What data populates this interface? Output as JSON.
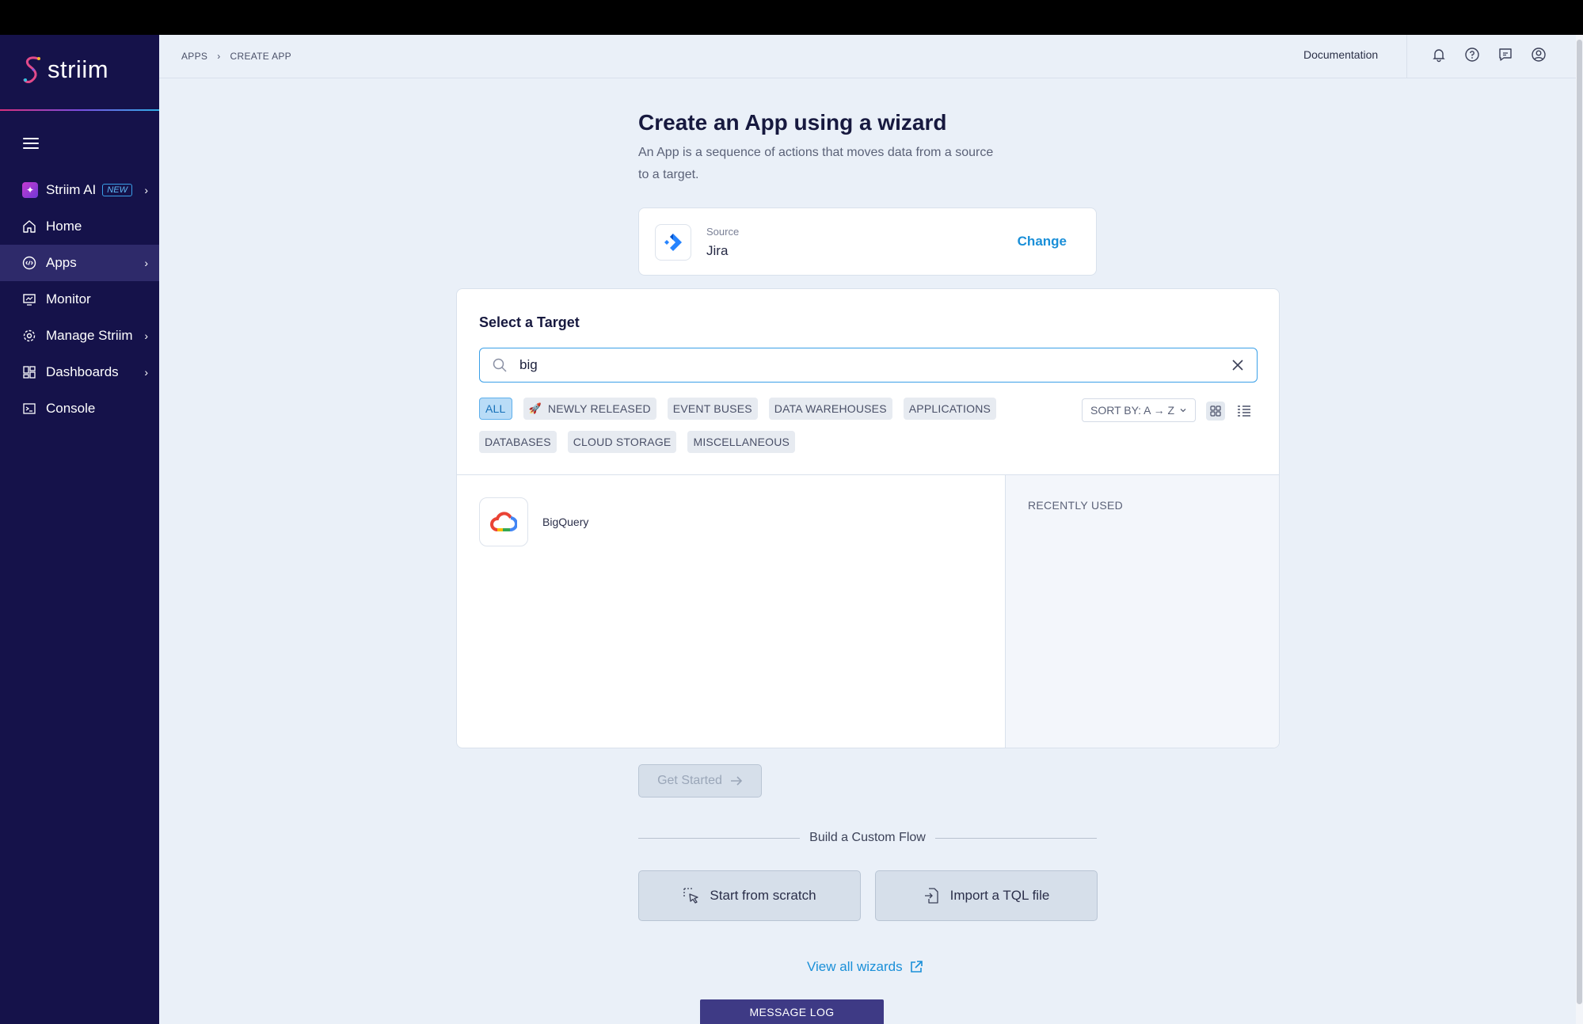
{
  "app": {
    "brand": "striim"
  },
  "sidebar": {
    "items": [
      {
        "label": "Striim AI",
        "badge": "NEW",
        "icon": "sparkle-icon"
      },
      {
        "label": "Home",
        "icon": "home-icon"
      },
      {
        "label": "Apps",
        "icon": "apps-icon"
      },
      {
        "label": "Monitor",
        "icon": "monitor-icon"
      },
      {
        "label": "Manage Striim",
        "icon": "gear-icon"
      },
      {
        "label": "Dashboards",
        "icon": "dashboard-icon"
      },
      {
        "label": "Console",
        "icon": "terminal-icon"
      }
    ]
  },
  "header": {
    "breadcrumb": [
      "APPS",
      "CREATE APP"
    ],
    "breadcrumb_sep": "›",
    "documentation": "Documentation"
  },
  "page": {
    "title": "Create an App using a wizard",
    "subtitle": "An App is a sequence of actions that moves data from a source to a target."
  },
  "source": {
    "label": "Source",
    "value": "Jira",
    "change": "Change"
  },
  "target": {
    "title": "Select a Target",
    "search_value": "big",
    "chips": [
      "ALL",
      "NEWLY RELEASED",
      "EVENT BUSES",
      "DATA WAREHOUSES",
      "APPLICATIONS",
      "DATABASES",
      "CLOUD STORAGE",
      "MISCELLANEOUS"
    ],
    "active_chip": "ALL",
    "sort": "SORT BY: A → Z",
    "results": [
      {
        "name": "BigQuery",
        "icon": "google-cloud-icon"
      }
    ],
    "recently_used_title": "RECENTLY USED"
  },
  "actions": {
    "get_started": "Get Started",
    "custom_flow_label": "Build a Custom Flow",
    "start_from_scratch": "Start from scratch",
    "import_tql": "Import a TQL file",
    "view_all_wizards": "View all wizards"
  },
  "footer": {
    "message_log": "MESSAGE LOG"
  },
  "colors": {
    "sidebar_bg": "#15124a",
    "main_bg": "#eaf0f8",
    "accent": "#1a8fd8",
    "active_nav": "#2e2a6a"
  }
}
